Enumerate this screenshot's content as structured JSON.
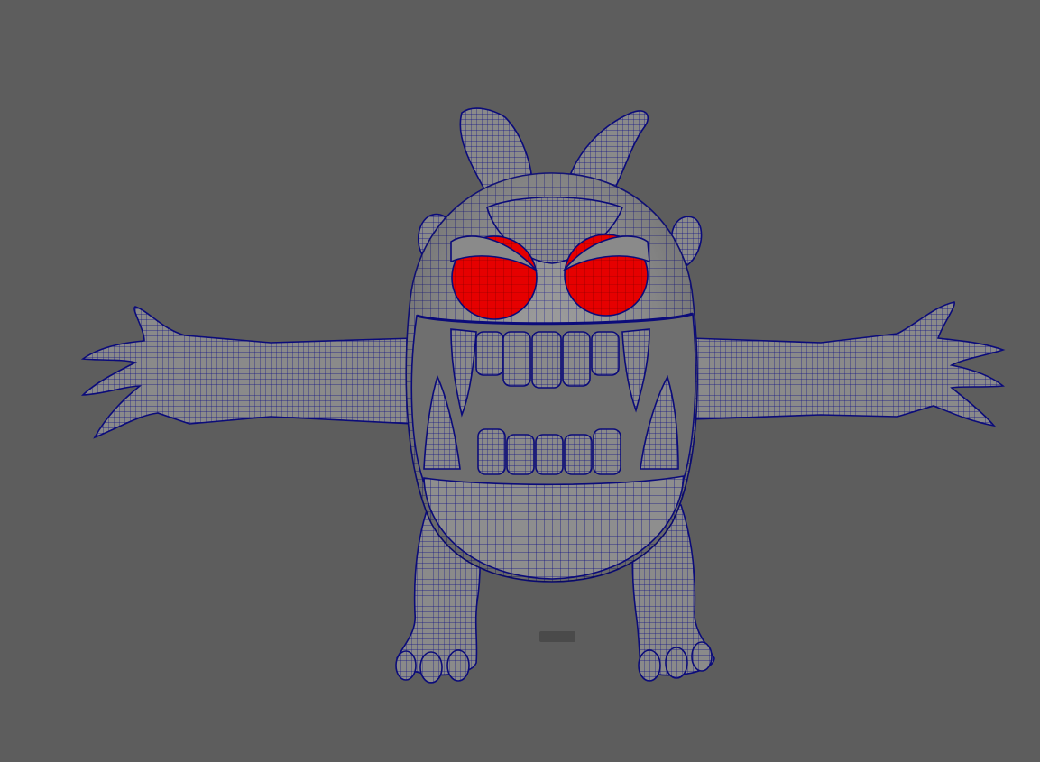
{
  "viewport": {
    "background_color": "#5d5d5d",
    "model": {
      "name_visible": false,
      "description_icon": "monster-wireframe-model",
      "surface_color": "#8c8c8c",
      "wire_color": "#0b0b7a",
      "eye_color": "#e60000"
    },
    "manipulator_icon": "ground-marker-icon"
  }
}
